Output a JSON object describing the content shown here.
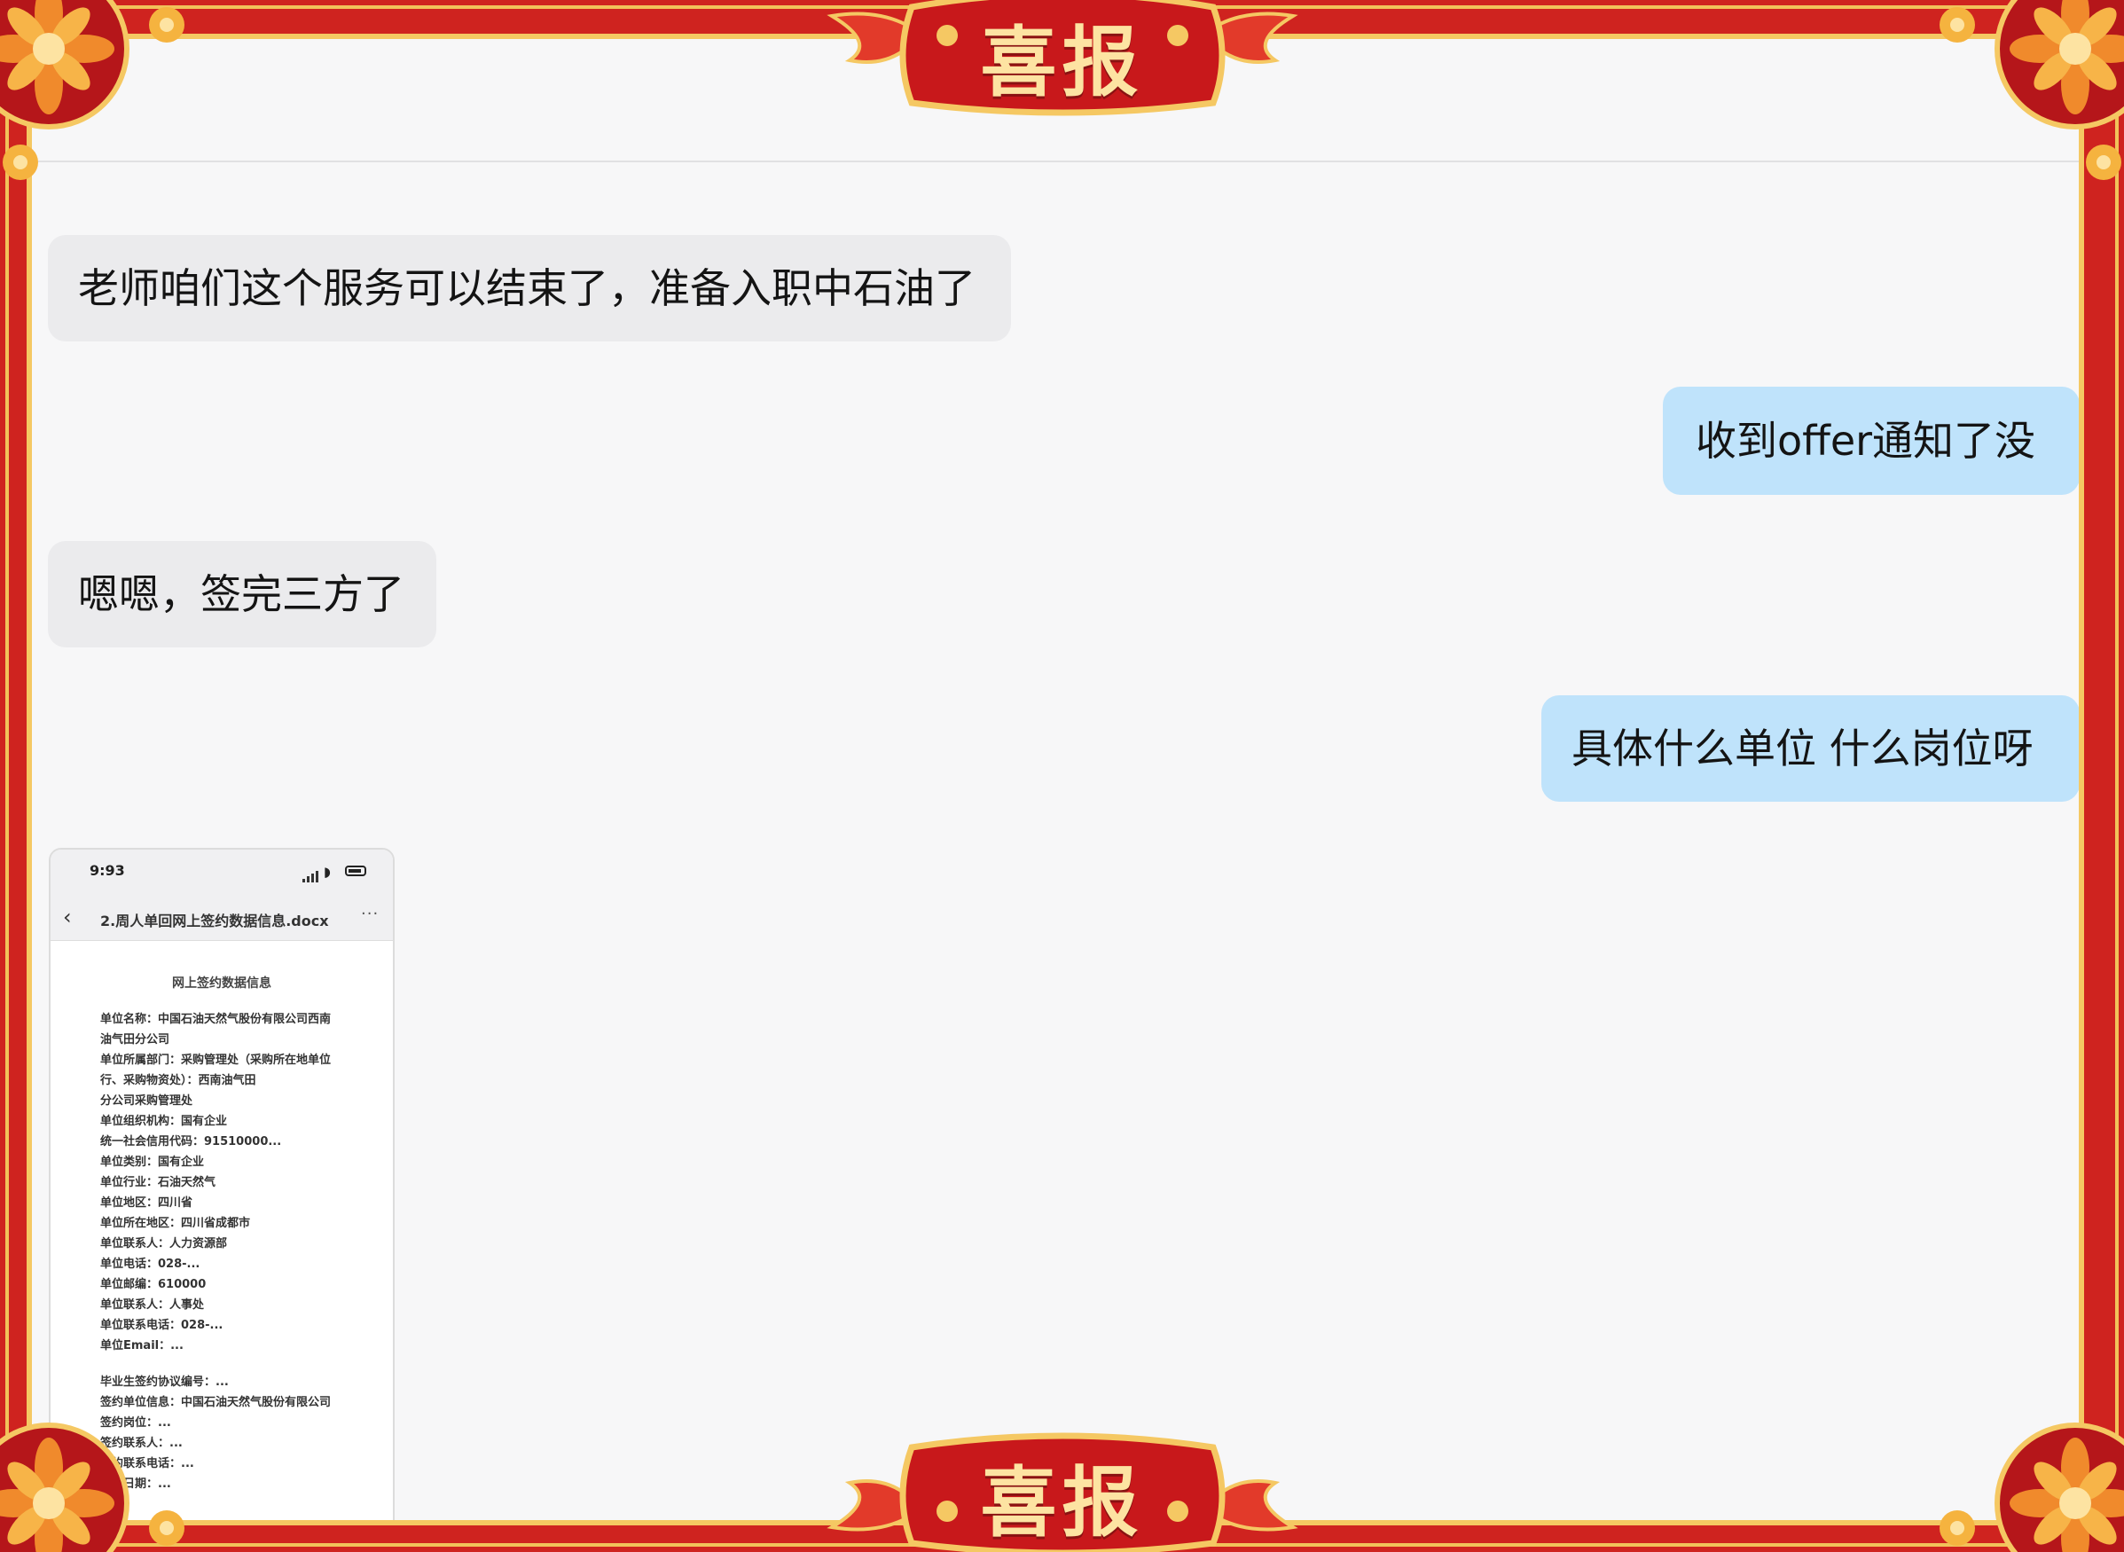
{
  "banner": {
    "top_title": "喜报",
    "bottom_title": "喜报"
  },
  "colors": {
    "frame_red": "#cf231f",
    "gold": "#f5c863",
    "panel": "#f7f7f8",
    "received_bubble": "#ebebed",
    "sent_bubble": "#bfe3fb"
  },
  "messages": [
    {
      "side": "left",
      "text": "老师咱们这个服务可以结束了，准备入职中石油了"
    },
    {
      "side": "right",
      "text": "收到offer通知了没"
    },
    {
      "side": "left",
      "text": "嗯嗯，签完三方了"
    },
    {
      "side": "right",
      "text": "具体什么单位 什么岗位呀"
    }
  ],
  "screenshot": {
    "status_time": "9:93",
    "nav_title": "2.周人单回网上签约数据信息.docx",
    "doc_heading": "网上签约数据信息",
    "doc_lines": [
      "单位名称：中国石油天然气股份有限公司西南",
      "油气田分公司",
      "单位所属部门：采购管理处（采购所在地单位",
      "行、采购物资处）：西南油气田",
      "分公司采购管理处",
      "单位组织机构：国有企业",
      "统一社会信用代码：91510000...",
      "单位类别：国有企业",
      "单位行业：石油天然气",
      "单位地区：四川省",
      "单位所在地区：四川省成都市",
      "单位联系人：人力资源部",
      "单位电话：028-...",
      "单位邮编：610000",
      "单位联系人：人事处",
      "单位联系电话：028-...",
      "单位Email：..."
    ],
    "doc_lines_2": [
      "毕业生签约协议编号：...",
      "签约单位信息：中国石油天然气股份有限公司",
      "签约岗位：...",
      "签约联系人：...",
      "签约联系电话：...",
      "签约日期：..."
    ]
  }
}
